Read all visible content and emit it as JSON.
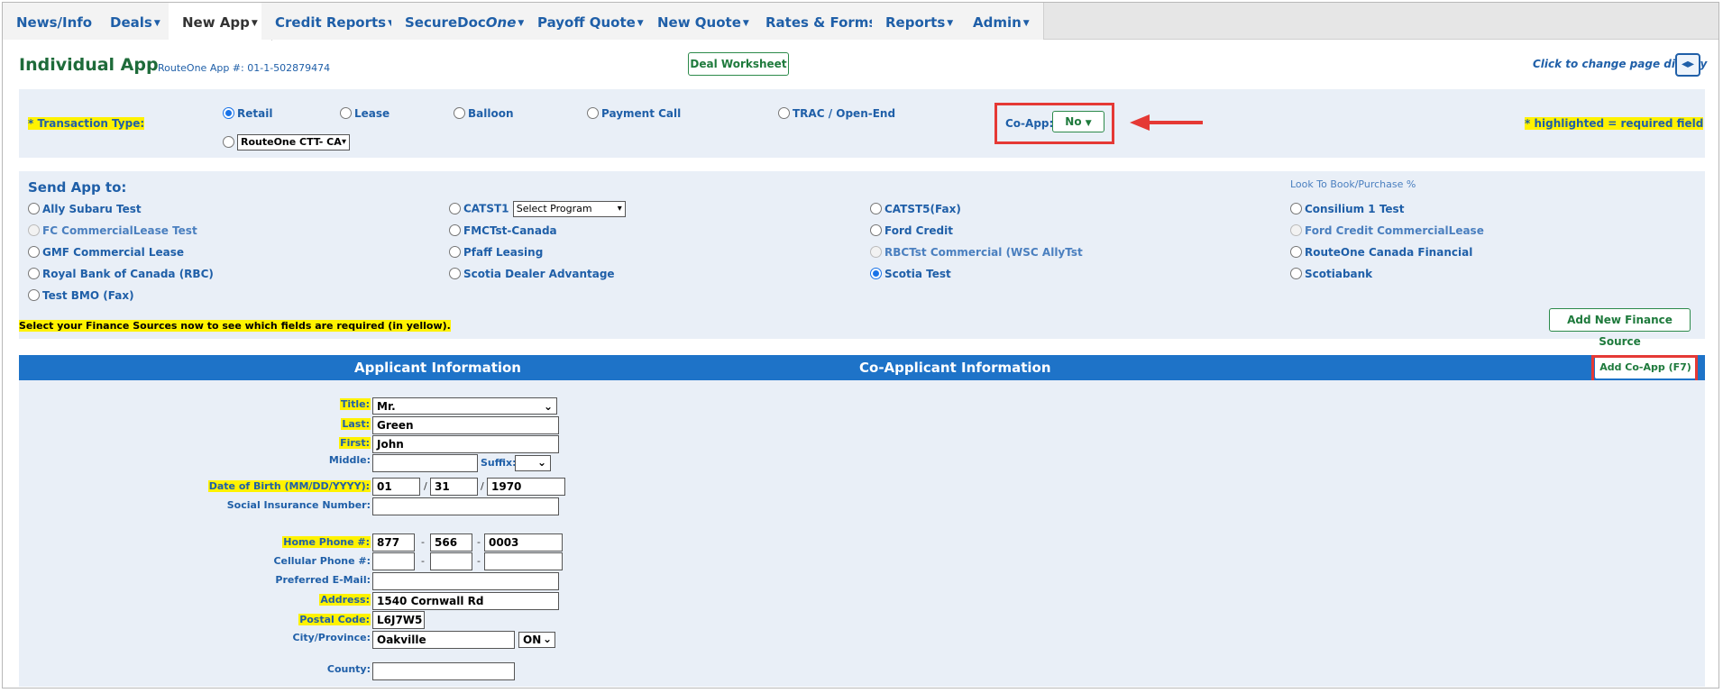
{
  "nav": {
    "tabs": [
      {
        "label": "News/Info",
        "caret": false
      },
      {
        "label": "Deals",
        "caret": true
      },
      {
        "label": "New App",
        "caret": true,
        "active": true
      },
      {
        "label": "Credit Reports",
        "caret": true
      },
      {
        "label_prefix": "SecureDoc",
        "label_suffix": "One",
        "caret": true
      },
      {
        "label": "Payoff Quote",
        "caret": true
      },
      {
        "label": "New Quote",
        "caret": true
      },
      {
        "label": "Rates & Forms",
        "caret": false
      },
      {
        "label": "Reports",
        "caret": true
      },
      {
        "label": "Admin",
        "caret": true
      }
    ]
  },
  "header": {
    "title": "Individual App",
    "app_number": "RouteOne App #: 01-1-502879474",
    "deal_worksheet": "Deal Worksheet",
    "change_display": "Click to change page display",
    "toggle_glyph": "◂▸"
  },
  "transaction": {
    "label": "* Transaction Type:",
    "options": [
      "Retail",
      "Lease",
      "Balloon",
      "Payment Call",
      "TRAC / Open-End"
    ],
    "selected": "Retail",
    "program_select": "RouteOne CTT- CA",
    "coapp_label": "Co-App:",
    "coapp_value": "No",
    "required_note": "* highlighted = required field"
  },
  "send_app": {
    "title": "Send App to:",
    "look_to_book": "Look To Book/Purchase %",
    "col1": [
      "Ally Subaru Test",
      "FC CommercialLease Test",
      "GMF Commercial Lease",
      "Royal Bank of Canada (RBC)",
      "Test BMO (Fax)"
    ],
    "col2": [
      "CATST1",
      "FMCTst-Canada",
      "Pfaff Leasing",
      "Scotia Dealer Advantage"
    ],
    "col2_select": "Select Program",
    "col3": [
      "CATST5(Fax)",
      "Ford Credit",
      "RBCTst Commercial (WSC AllyTst",
      "Scotia Test"
    ],
    "col4": [
      "Consilium 1 Test",
      "Ford Credit CommercialLease",
      "RouteOne Canada Financial",
      "Scotiabank"
    ],
    "selected": "Scotia Test",
    "note": "Select your Finance Sources now to see which fields are required (in yellow).",
    "add_source": "Add New Finance Source"
  },
  "sections": {
    "applicant": "Applicant Information",
    "coapplicant": "Co-Applicant Information",
    "add_coapp": "Add Co-App  (F7)"
  },
  "form": {
    "title_label": "Title:",
    "title_value": "Mr.",
    "last_label": "Last:",
    "last_value": "Green",
    "first_label": "First:",
    "first_value": "John",
    "middle_label": "Middle:",
    "middle_value": "",
    "suffix_label": "Suffix:",
    "suffix_value": "",
    "dob_label": "Date of Birth (MM/DD/YYYY):",
    "dob_mm": "01",
    "dob_dd": "31",
    "dob_yyyy": "1970",
    "sin_label": "Social Insurance Number:",
    "sin_value": "",
    "home_phone_label": "Home Phone #:",
    "home_phone": [
      "877",
      "566",
      "0003"
    ],
    "cell_phone_label": "Cellular Phone #:",
    "cell_phone": [
      "",
      "",
      ""
    ],
    "email_label": "Preferred E-Mail:",
    "email_value": "",
    "address_label": "Address:",
    "address_value": "1540 Cornwall Rd",
    "postal_label": "Postal Code:",
    "postal_value": "L6J7W5",
    "city_label": "City/Province:",
    "city_value": "Oakville",
    "province_value": "ON",
    "county_label": "County:",
    "county_value": ""
  },
  "colors": {
    "nav_text": "#1f5fa8",
    "title_green": "#1e6b3a",
    "header_bar": "#1e73c8",
    "highlight": "#fff200",
    "annotation_red": "#e53935",
    "panel_bg": "#e9eff7"
  }
}
